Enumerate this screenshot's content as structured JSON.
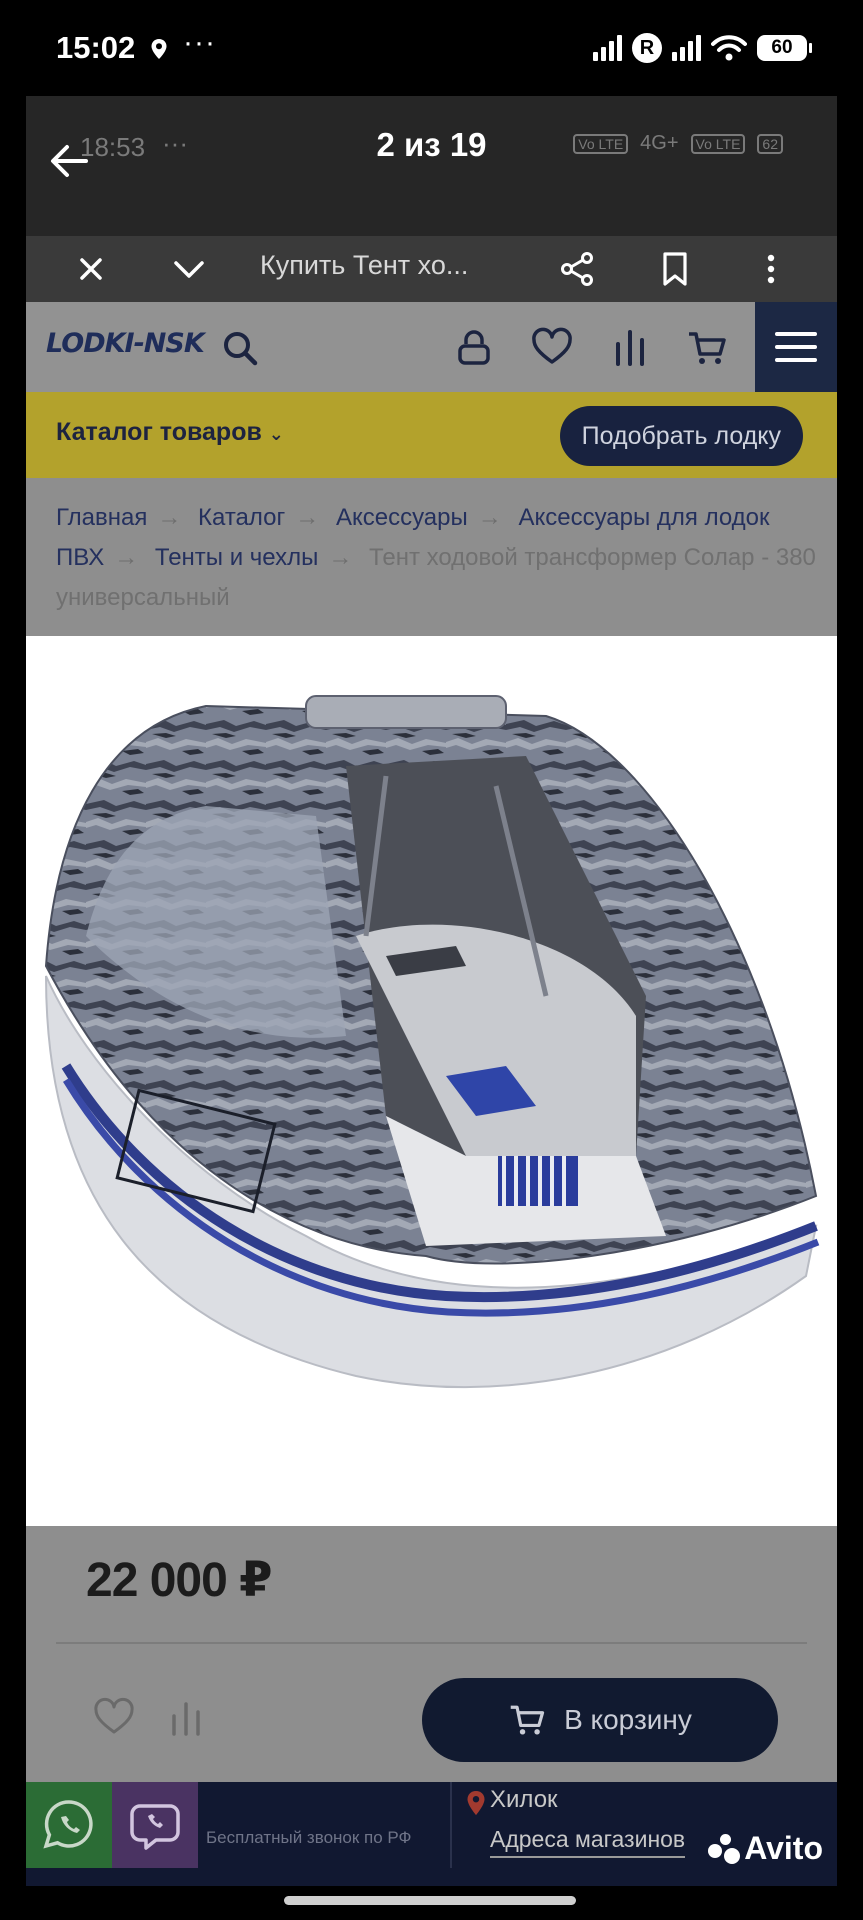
{
  "status_bar": {
    "time": "15:02",
    "dots": "···",
    "r_badge": "R",
    "battery": "60"
  },
  "viewer": {
    "counter": "2 из 19",
    "ghost_time": "18:53",
    "ghost_dots": "···",
    "ghost_badges": [
      "Vo LTE",
      "4G+",
      "Vo LTE"
    ],
    "ghost_battery": "62",
    "page_title": "Купить Тент хо..."
  },
  "site": {
    "logo": "LODKI-NSK",
    "catalog_label": "Каталог товаров",
    "pick_boat_label": "Подобрать лодку",
    "breadcrumbs": [
      "Главная",
      "Каталог",
      "Аксессуары",
      "Аксессуары для лодок ПВХ",
      "Тенты и чехлы"
    ],
    "breadcrumb_current": "Тент ходовой трансформер Солар - 380 универсальный",
    "price": "22 000 ₽",
    "cart_button": "В корзину",
    "footer": {
      "free_call": "Бесплатный звонок по РФ",
      "city": "Хилок",
      "stores_link": "Адреса магазинов"
    }
  },
  "watermark": "Avito",
  "colors": {
    "nav_dark": "#1c2844",
    "yellow_bar": "#b3a22c",
    "button_dark": "#111a30",
    "whatsapp": "#2b6c35",
    "viber": "#4a3362"
  },
  "icons": [
    "location-icon",
    "signal-icon",
    "wifi-icon",
    "battery-icon",
    "back-arrow-icon",
    "close-icon",
    "chevron-down-icon",
    "share-icon",
    "bookmark-icon",
    "more-vertical-icon",
    "search-icon",
    "account-icon",
    "heart-icon",
    "compare-icon",
    "cart-icon",
    "menu-icon",
    "whatsapp-icon",
    "viber-icon",
    "map-pin-icon"
  ]
}
